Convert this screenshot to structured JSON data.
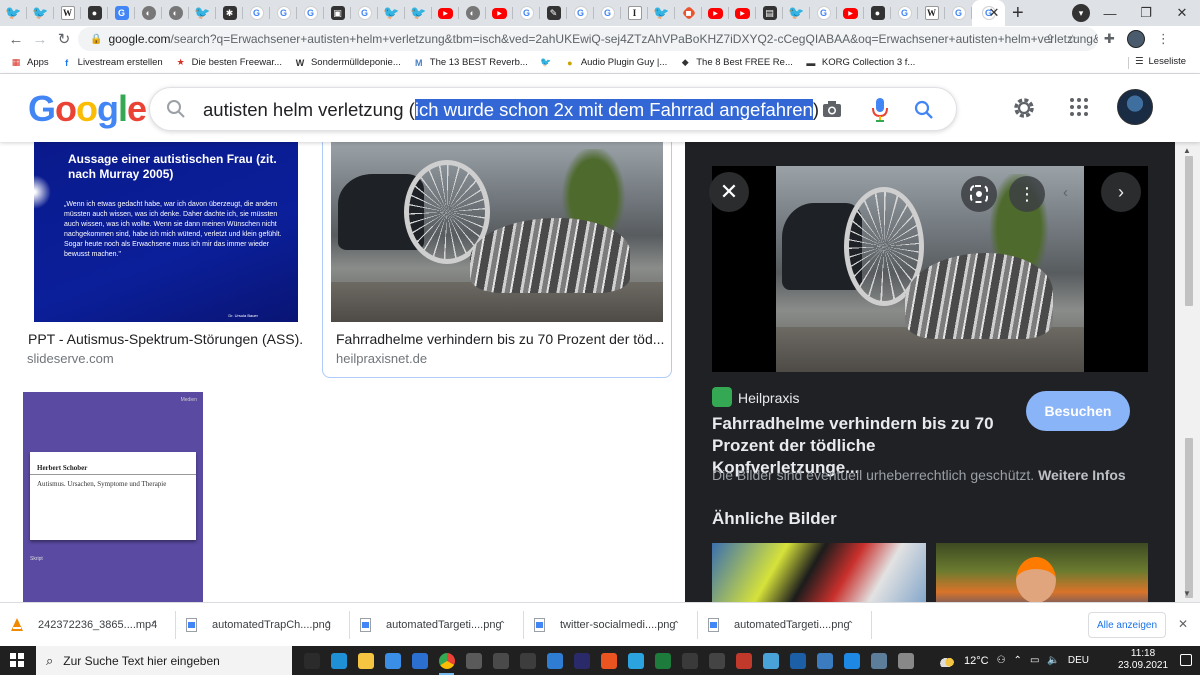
{
  "browser": {
    "tabs": [
      {
        "icon": "twitter-icon",
        "glyph": "🐦",
        "cls": "tw"
      },
      {
        "icon": "twitter-icon",
        "glyph": "🐦",
        "cls": "tw"
      },
      {
        "icon": "wikipedia-icon",
        "glyph": "W",
        "cls": "w"
      },
      {
        "icon": "github-icon",
        "glyph": "●",
        "cls": "dk"
      },
      {
        "icon": "translate-icon",
        "glyph": "G",
        "cls": "bl"
      },
      {
        "icon": "tab-icon",
        "glyph": "◐",
        "cls": "gy"
      },
      {
        "icon": "tab-icon",
        "glyph": "◐",
        "cls": "gy"
      },
      {
        "icon": "twitter-icon",
        "glyph": "🐦",
        "cls": "tw"
      },
      {
        "icon": "asterisk-icon",
        "glyph": "✱",
        "cls": "dk"
      },
      {
        "icon": "google-icon",
        "glyph": "G",
        "cls": "g"
      },
      {
        "icon": "google-icon",
        "glyph": "G",
        "cls": "g"
      },
      {
        "icon": "google-icon",
        "glyph": "G",
        "cls": "g"
      },
      {
        "icon": "tab-icon",
        "glyph": "▣",
        "cls": "dk"
      },
      {
        "icon": "google-icon",
        "glyph": "G",
        "cls": "g"
      },
      {
        "icon": "twitter-icon",
        "glyph": "🐦",
        "cls": "tw"
      },
      {
        "icon": "twitter-icon",
        "glyph": "🐦",
        "cls": "tw"
      },
      {
        "icon": "youtube-icon",
        "glyph": "▶",
        "cls": "yt"
      },
      {
        "icon": "tab-icon",
        "glyph": "◐",
        "cls": "gy"
      },
      {
        "icon": "youtube-icon",
        "glyph": "▶",
        "cls": "yt"
      },
      {
        "icon": "google-icon",
        "glyph": "G",
        "cls": "g"
      },
      {
        "icon": "tab-icon",
        "glyph": "✎",
        "cls": "dk"
      },
      {
        "icon": "google-icon",
        "glyph": "G",
        "cls": "g"
      },
      {
        "icon": "google-icon",
        "glyph": "G",
        "cls": "g"
      },
      {
        "icon": "tab-icon",
        "glyph": "I",
        "cls": "w"
      },
      {
        "icon": "twitter-icon",
        "glyph": "🐦",
        "cls": "tw"
      },
      {
        "icon": "tab-icon",
        "glyph": "◆",
        "cls": "or"
      },
      {
        "icon": "youtube-icon",
        "glyph": "▶",
        "cls": "yt"
      },
      {
        "icon": "youtube-icon",
        "glyph": "▶",
        "cls": "yt"
      },
      {
        "icon": "tab-icon",
        "glyph": "▤",
        "cls": "dk"
      },
      {
        "icon": "twitter-icon",
        "glyph": "🐦",
        "cls": "tw"
      },
      {
        "icon": "google-icon",
        "glyph": "G",
        "cls": "g"
      },
      {
        "icon": "youtube-icon",
        "glyph": "▶",
        "cls": "yt"
      },
      {
        "icon": "tab-icon",
        "glyph": "●",
        "cls": "dk"
      },
      {
        "icon": "google-icon",
        "glyph": "G",
        "cls": "g"
      },
      {
        "icon": "wikipedia-icon",
        "glyph": "W",
        "cls": "w"
      },
      {
        "icon": "google-icon",
        "glyph": "G",
        "cls": "g"
      },
      {
        "icon": "google-icon",
        "glyph": "G",
        "cls": "g",
        "active": true
      }
    ],
    "close_tab": "✕",
    "new_tab": "+",
    "window": {
      "minimize": "—",
      "restore": "❐",
      "close": "✕"
    },
    "url_host": "google.com",
    "url_rest": "/search?q=Erwachsener+autisten+helm+verletzung&tbm=isch&ved=2ahUKEwiQ-sej4ZTzAhVPaBoKHZ7iDXYQ2-cCegQIABAA&oq=Erwachsener+autisten+helm+verletzung&gs_lcp=CgNpb...",
    "bookmarks": [
      {
        "label": "Apps",
        "icon": "apps-icon",
        "glyph": "▦",
        "color": "#d93025"
      },
      {
        "label": "Livestream erstellen",
        "icon": "facebook-icon",
        "glyph": "f",
        "color": "#1877f2"
      },
      {
        "label": "Die besten Freewar...",
        "icon": "star-icon",
        "glyph": "★",
        "color": "#d93025"
      },
      {
        "label": "Sondermülldeponie...",
        "icon": "bookmark-w-icon",
        "glyph": "W",
        "color": "#333333"
      },
      {
        "label": "The 13 BEST Reverb...",
        "icon": "bookmark-m-icon",
        "glyph": "M",
        "color": "#4a7fc1"
      },
      {
        "label": "",
        "icon": "twitter-icon",
        "glyph": "🐦",
        "color": "#1d9bf0"
      },
      {
        "label": "Audio Plugin Guy |...",
        "icon": "audio-plugin-icon",
        "glyph": "●",
        "color": "#c8a400"
      },
      {
        "label": "The 8 Best FREE Re...",
        "icon": "bookmark-icon",
        "glyph": "◆",
        "color": "#333333"
      },
      {
        "label": "KORG Collection 3 f...",
        "icon": "korg-icon",
        "glyph": "▬",
        "color": "#333333"
      }
    ],
    "reading_list": "Leseliste"
  },
  "google": {
    "logo": [
      "G",
      "o",
      "o",
      "g",
      "l",
      "e"
    ],
    "query_prefix": "autisten helm verletzung (",
    "query_selected": "ich wurde schon 2x mit dem Fahrrad angefahren",
    "query_suffix": ")"
  },
  "results": [
    {
      "caption": "PPT - Autismus-Spektrum-Störungen (ASS)...",
      "source": "slideserve.com",
      "slide_title": "Aussage einer autistischen Frau (zit. nach Murray 2005)",
      "slide_text": "„Wenn ich etwas gedacht habe, war ich davon überzeugt, die andern müssten auch wissen, was ich denke. Daher dachte ich, sie müssten auch wissen, was ich wollte. Wenn sie dann meinen Wünschen nicht nachgekommen sind, habe ich mich wütend, verletzt und klein gefühlt. Sogar heute noch als Erwachsene muss ich mir das immer wieder bewusst machen.\"",
      "slide_small": "Dr. Ursula Bauer"
    },
    {
      "caption": "Fahrradhelme verhindern bis zu 70 Prozent der töd...",
      "source": "heilpraxisnet.de",
      "selected": true
    },
    {
      "book_author": "Herbert Schober",
      "book_title": "Autismus. Ursachen, Symptome und Therapie",
      "book_publisher": "Medien",
      "book_tag": "Skript"
    }
  ],
  "panel": {
    "close": "✕",
    "next": "›",
    "prev": "‹",
    "more": "⋮",
    "site": "Heilpraxis",
    "title": "Fahrradhelme verhindern bis zu 70 Prozent der tödliche Kopfverletzunge...",
    "visit": "Besuchen",
    "copyright": "Die Bilder sind eventuell urheberrechtlich geschützt.",
    "more_info": "Weitere Infos",
    "similar": "Ähnliche Bilder"
  },
  "downloads": [
    {
      "name": "242372236_3865....mp4",
      "icon": "vlc-icon"
    },
    {
      "name": "automatedTrapCh....png",
      "icon": "image-file-icon"
    },
    {
      "name": "automatedTargeti....png",
      "icon": "image-file-icon"
    },
    {
      "name": "twitter-socialmedi....png",
      "icon": "image-file-icon"
    },
    {
      "name": "automatedTargeti....png",
      "icon": "image-file-icon"
    }
  ],
  "show_all": "Alle anzeigen",
  "taskbar": {
    "search_placeholder": "Zur Suche Text hier eingeben",
    "apps": [
      {
        "icon": "task-view-icon",
        "color": "#2b2b2b"
      },
      {
        "icon": "edge-icon",
        "color": "#1f8fd6"
      },
      {
        "icon": "file-explorer-icon",
        "color": "#f5c542"
      },
      {
        "icon": "store-icon",
        "color": "#3a8ee6"
      },
      {
        "icon": "mail-icon",
        "color": "#2b6fd1"
      },
      {
        "icon": "chrome-icon",
        "color": "#e8a33d",
        "running": true
      },
      {
        "icon": "app-icon",
        "color": "#5a5a5a"
      },
      {
        "icon": "app-icon",
        "color": "#4a4a4a"
      },
      {
        "icon": "live-icon",
        "color": "#3d3d3d"
      },
      {
        "icon": "app-icon",
        "color": "#2f7dd3"
      },
      {
        "icon": "app-icon",
        "color": "#2a2a6a"
      },
      {
        "icon": "ubuntu-icon",
        "color": "#e95420"
      },
      {
        "icon": "telegram-icon",
        "color": "#2aa3df"
      },
      {
        "icon": "app-icon",
        "color": "#1d7b3b"
      },
      {
        "icon": "kali-icon",
        "color": "#3a3a3a"
      },
      {
        "icon": "app-icon",
        "color": "#444444"
      },
      {
        "icon": "voicemeeter-icon",
        "color": "#c0392b"
      },
      {
        "icon": "app-icon",
        "color": "#4aa3d8"
      },
      {
        "icon": "virtualbox-icon",
        "color": "#1d5fa6"
      },
      {
        "icon": "app-icon",
        "color": "#3b7bbf"
      },
      {
        "icon": "app-icon",
        "color": "#1e88e5"
      },
      {
        "icon": "app-icon",
        "color": "#5d7e9a"
      },
      {
        "icon": "app-icon",
        "color": "#888888"
      }
    ],
    "temperature": "12°C",
    "language": "DEU",
    "time": "11:18",
    "date": "23.09.2021"
  },
  "colors": {
    "accent": "#1a73e8",
    "selection": "#3367d6",
    "panel_bg": "#202124",
    "visit_button": "#8ab4f8"
  }
}
